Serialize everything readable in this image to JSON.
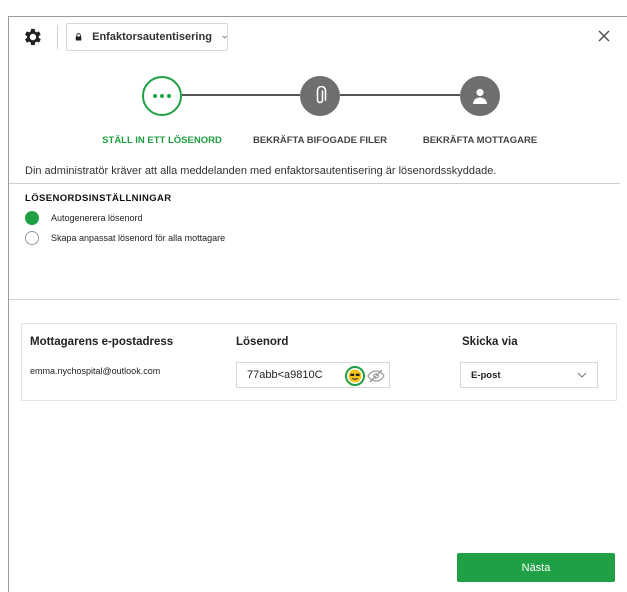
{
  "header": {
    "mode_label": "Enfaktorsautentisering",
    "icons": {
      "settings": "gear-icon",
      "lock": "lock-icon",
      "dropdown": "chevron-down-icon",
      "close": "close-icon"
    }
  },
  "steps": [
    {
      "label": "STÄLL IN ETT LÖSENORD",
      "icon": "ellipsis-icon",
      "active": true
    },
    {
      "label": "BEKRÄFTA BIFOGADE FILER",
      "icon": "paperclip-icon",
      "active": false
    },
    {
      "label": "BEKRÄFTA MOTTAGARE",
      "icon": "person-icon",
      "active": false
    }
  ],
  "info_text": "Din administratör kräver att alla meddelanden med enfaktorsautentisering är lösenordsskyddade.",
  "password_settings": {
    "title": "LÖSENORDSINSTÄLLNINGAR",
    "options": [
      {
        "label": "Autogenerera lösenord",
        "selected": true
      },
      {
        "label": "Skapa anpassat lösenord för alla mottagare",
        "selected": false
      }
    ]
  },
  "recipients": {
    "headers": {
      "email": "Mottagarens e-postadress",
      "password": "Lösenord",
      "send_via": "Skicka via"
    },
    "rows": [
      {
        "email": "emma.nychospital@outlook.com",
        "password": "77abb<a9810C",
        "send_via": "E-post"
      }
    ]
  },
  "next_label": "Nästa",
  "colors": {
    "accent": "#1fa044",
    "step_inactive": "#6e6e6e"
  }
}
